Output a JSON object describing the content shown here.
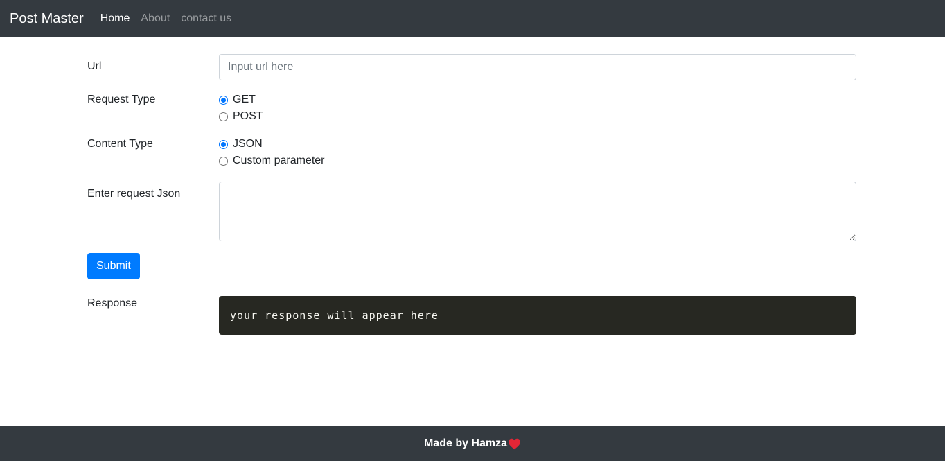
{
  "navbar": {
    "brand": "Post Master",
    "links": [
      {
        "label": "Home",
        "active": true
      },
      {
        "label": "About",
        "active": false
      },
      {
        "label": "contact us",
        "active": false
      }
    ]
  },
  "form": {
    "url": {
      "label": "Url",
      "placeholder": "Input url here",
      "value": ""
    },
    "request_type": {
      "label": "Request Type",
      "options": [
        {
          "label": "GET",
          "checked": true
        },
        {
          "label": "POST",
          "checked": false
        }
      ]
    },
    "content_type": {
      "label": "Content Type",
      "options": [
        {
          "label": "JSON",
          "checked": true
        },
        {
          "label": "Custom parameter",
          "checked": false
        }
      ]
    },
    "request_json": {
      "label": "Enter request Json",
      "value": ""
    },
    "submit_label": "Submit"
  },
  "response": {
    "label": "Response",
    "text": "your response will appear here"
  },
  "footer": {
    "text": "Made by Hamza",
    "icon": "heart-icon",
    "icon_color": "#e32636"
  },
  "colors": {
    "navbar_bg": "#343a40",
    "primary": "#007bff",
    "response_bg": "#272822"
  }
}
